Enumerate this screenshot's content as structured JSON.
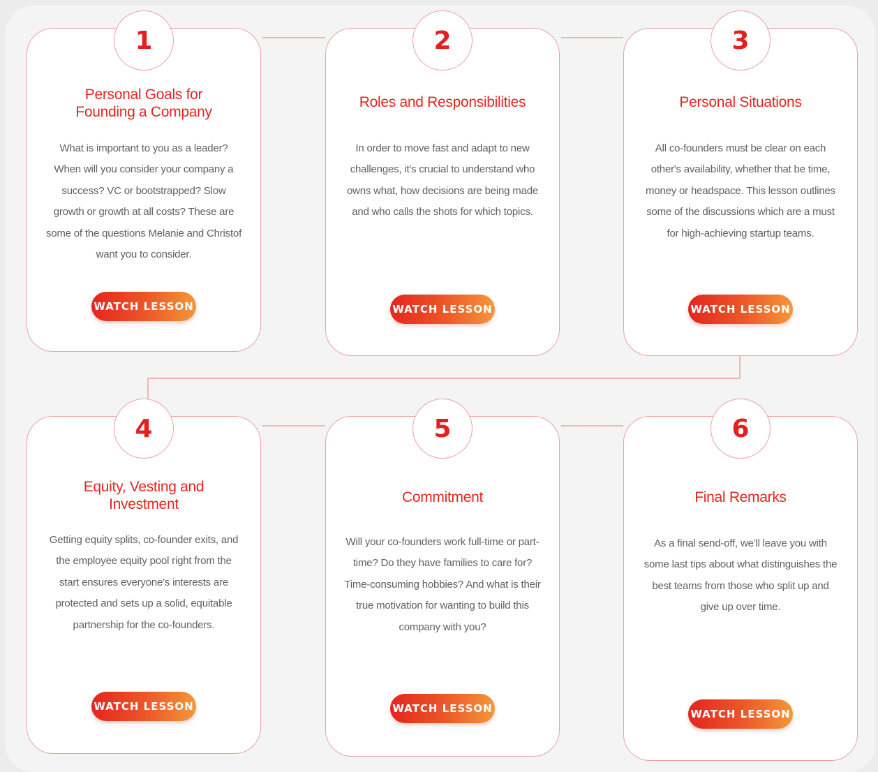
{
  "colors": {
    "accent": "#e52521",
    "border": "#f0a0a0",
    "button_gradient_start": "#e3261f",
    "button_gradient_end": "#f3983a",
    "body_text": "#606060",
    "background": "#f4f4f4"
  },
  "lessons": [
    {
      "number": "1",
      "title": "Personal Goals for\nFounding a Company",
      "description": "What is important to you as a leader? When will you consider your company a success? VC or bootstrapped? Slow growth or growth at all costs? These are some of the questions Melanie and Christof want you to consider.",
      "button_label": "WATCH LESSON"
    },
    {
      "number": "2",
      "title": "Roles and Responsibilities",
      "description": "In order to move fast and adapt to new challenges, it's crucial to understand who owns what, how decisions are being made and who calls the shots for which topics.",
      "button_label": "WATCH LESSON"
    },
    {
      "number": "3",
      "title": "Personal Situations",
      "description": "All co-founders must be clear on each other's availability, whether that be time, money or headspace. This lesson outlines some of the discussions which are a must for high-achieving startup teams.",
      "button_label": "WATCH LESSON"
    },
    {
      "number": "4",
      "title": "Equity, Vesting and\nInvestment",
      "description": "Getting equity splits, co-founder exits, and the employee equity pool right from the start ensures everyone's interests are protected and sets up a solid, equitable partnership for the co-founders.",
      "button_label": "WATCH LESSON"
    },
    {
      "number": "5",
      "title": "Commitment",
      "description": "Will your co-founders work full-time or part-time? Do they have families to care for? Time-consuming hobbies? And what is their true motivation for wanting to build this company with you?",
      "button_label": "WATCH LESSON"
    },
    {
      "number": "6",
      "title": "Final Remarks",
      "description": "As a final send-off, we'll leave you with some last tips about what distinguishes the best teams from those who split up and give up over time.",
      "button_label": "WATCH LESSON"
    }
  ]
}
